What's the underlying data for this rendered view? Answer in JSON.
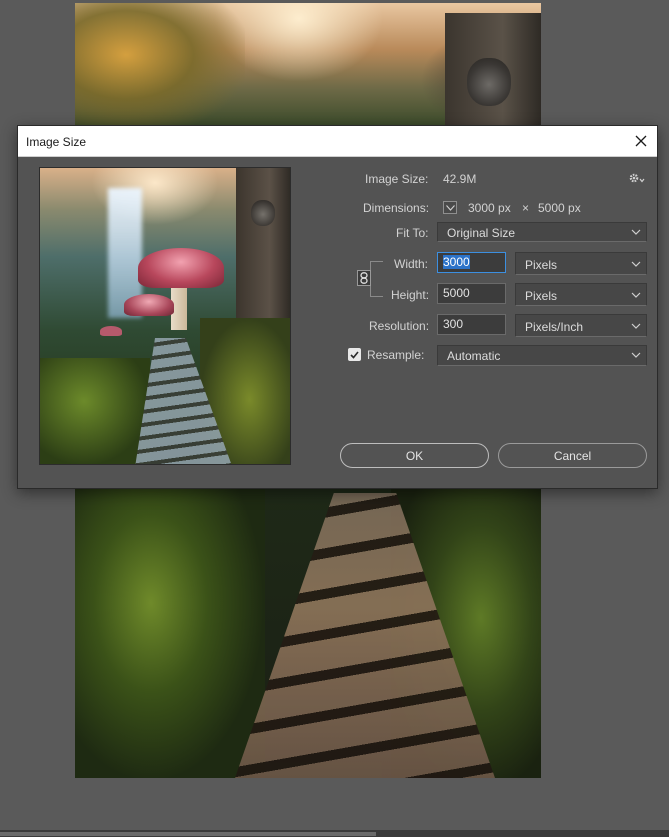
{
  "dialog": {
    "title": "Image Size",
    "image_size_label": "Image Size:",
    "image_size_value": "42.9M",
    "dimensions_label": "Dimensions:",
    "dimensions_width": "3000 px",
    "dimensions_sep": "×",
    "dimensions_height": "5000 px",
    "fit_to_label": "Fit To:",
    "fit_to_value": "Original Size",
    "width_label": "Width:",
    "width_value": "3000",
    "width_unit": "Pixels",
    "height_label": "Height:",
    "height_value": "5000",
    "height_unit": "Pixels",
    "resolution_label": "Resolution:",
    "resolution_value": "300",
    "resolution_unit": "Pixels/Inch",
    "resample_label": "Resample:",
    "resample_checked": true,
    "resample_value": "Automatic",
    "ok_label": "OK",
    "cancel_label": "Cancel"
  },
  "icons": {
    "close": "close-icon",
    "gear": "gear-icon",
    "chevron": "chevron-down-icon",
    "chain": "link-icon",
    "check": "check-icon"
  },
  "colors": {
    "dialog_bg": "#535353",
    "titlebar_bg": "#ffffff",
    "focus": "#3c8fe0",
    "selection": "#2c73c9"
  }
}
